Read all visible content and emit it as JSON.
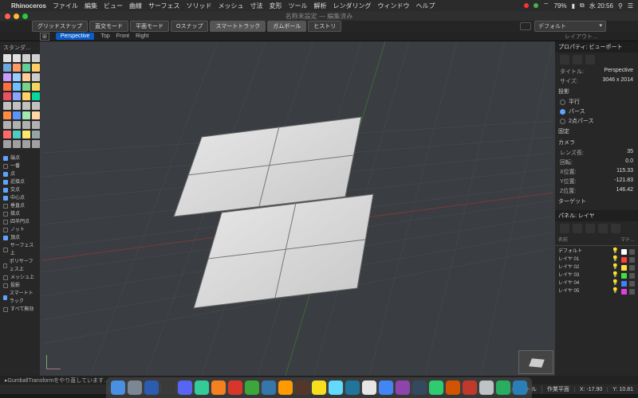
{
  "macmenu": {
    "app": "Rhinoceros",
    "items": [
      "ファイル",
      "編集",
      "ビュー",
      "曲線",
      "サーフェス",
      "ソリッド",
      "メッシュ",
      "寸法",
      "変形",
      "ツール",
      "解析",
      "レンダリング",
      "ウィンドウ",
      "ヘルプ"
    ],
    "status": {
      "battery": "79%",
      "clock": "水 20:56"
    }
  },
  "title": "名称未設定 — 編集済み",
  "toggles": [
    "グリッドスナップ",
    "直交モード",
    "平面モード",
    "Oスナップ",
    "スマートトラック",
    "ガムボール",
    "ヒストリ"
  ],
  "toggles_on": [
    4,
    5
  ],
  "style_combo": "デフォルト",
  "viewport_tabs": {
    "active": "Perspective",
    "others": [
      "Top",
      "Front",
      "Right"
    ],
    "layout_label": "レイアウト…"
  },
  "left_label": "スタンダ…",
  "osnaps": [
    {
      "label": "端点",
      "on": true
    },
    {
      "label": "一番",
      "on": false
    },
    {
      "label": "点",
      "on": true
    },
    {
      "label": "近接点",
      "on": true
    },
    {
      "label": "交点",
      "on": true
    },
    {
      "label": "中心点",
      "on": true
    },
    {
      "label": "垂直点",
      "on": false
    },
    {
      "label": "接点",
      "on": false
    },
    {
      "label": "四半円点",
      "on": false
    },
    {
      "label": "ノット",
      "on": false
    },
    {
      "label": "頂点",
      "on": true
    },
    {
      "label": "サーフェス上",
      "on": false
    },
    {
      "label": "ポリサーフェス上",
      "on": false
    },
    {
      "label": "メッシュ上",
      "on": false
    },
    {
      "label": "投影",
      "on": false
    },
    {
      "label": "スマートトラック",
      "on": true
    },
    {
      "label": "すべて無効",
      "on": false
    }
  ],
  "props": {
    "header": "プロパティ: ビューポート",
    "title_label": "タイトル:",
    "title_value": "Perspective",
    "size_label": "サイズ:",
    "size_value": "3046 x 2014",
    "proj_label": "投影",
    "proj_opts": [
      {
        "label": "平行",
        "on": false
      },
      {
        "label": "パース",
        "on": true
      },
      {
        "label": "2点パース",
        "on": false
      }
    ],
    "lock_label": "固定",
    "cam_label": "カメラ",
    "cam": [
      {
        "k": "レンズ長:",
        "v": "35"
      },
      {
        "k": "回転:",
        "v": "0.0"
      },
      {
        "k": "X位置:",
        "v": "115.33"
      },
      {
        "k": "Y位置:",
        "v": "-121.83"
      },
      {
        "k": "Z位置:",
        "v": "146.42"
      }
    ],
    "target_label": "ターゲット",
    "panel_label": "パネル: レイヤ",
    "layers_hdr": {
      "name": "名前",
      "mat": "マテ…"
    },
    "layers": [
      {
        "name": "デフォルト",
        "color": "#ffffff"
      },
      {
        "name": "レイヤ 01",
        "color": "#ff4040"
      },
      {
        "name": "レイヤ 02",
        "color": "#ffe040"
      },
      {
        "name": "レイヤ 03",
        "color": "#40e040"
      },
      {
        "name": "レイヤ 04",
        "color": "#4080ff"
      },
      {
        "name": "レイヤ 05",
        "color": "#e040e0"
      }
    ]
  },
  "cmd": "GumballTransformをやり直しています…",
  "status": {
    "units": "ミリメートル",
    "plane": "作業平面",
    "x_label": "X:",
    "x": "-17.90",
    "y_label": "Y:",
    "y": "10.81"
  },
  "tool_colors": [
    "#e0e0e0",
    "#e0e0e0",
    "#d0d0d0",
    "#d0d0d0",
    "#6fa8dc",
    "#ff9966",
    "#66cc99",
    "#ffcc66",
    "#cc99ff",
    "#99ccff",
    "#ffcc99",
    "#cccccc",
    "#ff6f3c",
    "#6ec1ff",
    "#7bd389",
    "#f4d35e",
    "#eb5160",
    "#8aa7ff",
    "#ffd166",
    "#06d6a0",
    "#c0c0c0",
    "#c0c0c0",
    "#c0c0c0",
    "#c0c0c0",
    "#ff8c42",
    "#5c95ff",
    "#a0e8af",
    "#ffd6a5",
    "#b0b0b0",
    "#b0b0b0",
    "#b0b0b0",
    "#b0b0b0",
    "#ff6b6b",
    "#4ecdc4",
    "#ffe66d",
    "#95a5a6",
    "#a0a0a0",
    "#a0a0a0",
    "#a0a0a0",
    "#a0a0a0"
  ],
  "dock_colors": [
    "#4a90e2",
    "#7b8794",
    "#2b5cb0",
    "#3a3a3a",
    "#5865f2",
    "#33cc99",
    "#f58020",
    "#d9362b",
    "#3ba639",
    "#3776ab",
    "#ff9a00",
    "#543729",
    "#f7df1e",
    "#61dafb",
    "#21759b",
    "#e6e6e6",
    "#4285f4",
    "#8e44ad",
    "#34495e",
    "#2ecc71",
    "#d35400",
    "#c0392b",
    "#bdc3c7",
    "#27ae60",
    "#2980b9"
  ]
}
